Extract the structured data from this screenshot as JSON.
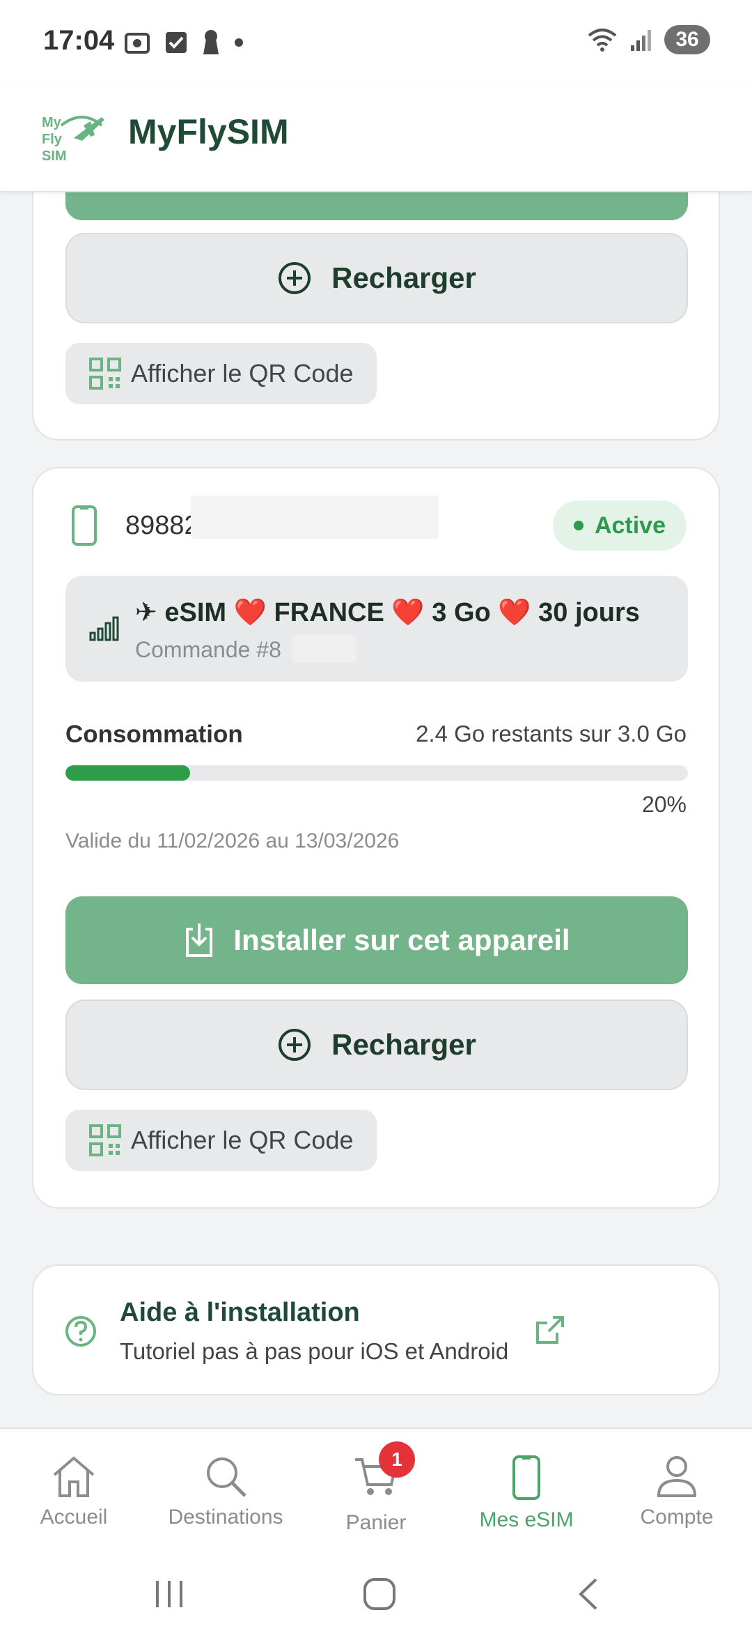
{
  "status_bar": {
    "time": "17:04",
    "battery": "36"
  },
  "header": {
    "title": "MyFlySIM",
    "logo_text": [
      "My",
      "Fly",
      "SIM"
    ]
  },
  "card1": {
    "recharge_label": "Recharger",
    "qr_label": "Afficher le QR Code"
  },
  "card2": {
    "iccid": "89882",
    "status": "Active",
    "plan_title": "✈ eSIM ❤️ FRANCE ❤️ 3 Go ❤️ 30 jours",
    "order": "Commande #8",
    "consumption_label": "Consommation",
    "consumption_value": "2.4 Go restants sur 3.0 Go",
    "usage_percent": 20,
    "usage_percent_text": "20%",
    "validity": "Valide du 11/02/2026 au 13/03/2026",
    "install_label": "Installer sur cet appareil",
    "recharge_label": "Recharger",
    "qr_label": "Afficher le QR Code"
  },
  "help": {
    "title": "Aide à l'installation",
    "subtitle": "Tutoriel pas à pas pour iOS et Android"
  },
  "nav": {
    "items": [
      {
        "label": "Accueil",
        "icon": "home-icon"
      },
      {
        "label": "Destinations",
        "icon": "search-icon"
      },
      {
        "label": "Panier",
        "icon": "cart-icon",
        "badge": "1"
      },
      {
        "label": "Mes eSIM",
        "icon": "phone-icon",
        "active": true
      },
      {
        "label": "Compte",
        "icon": "user-icon"
      }
    ]
  },
  "colors": {
    "brand": "#1f4a35",
    "accent": "#73b48a",
    "active": "#2b9a4d",
    "badge": "#e53238"
  }
}
